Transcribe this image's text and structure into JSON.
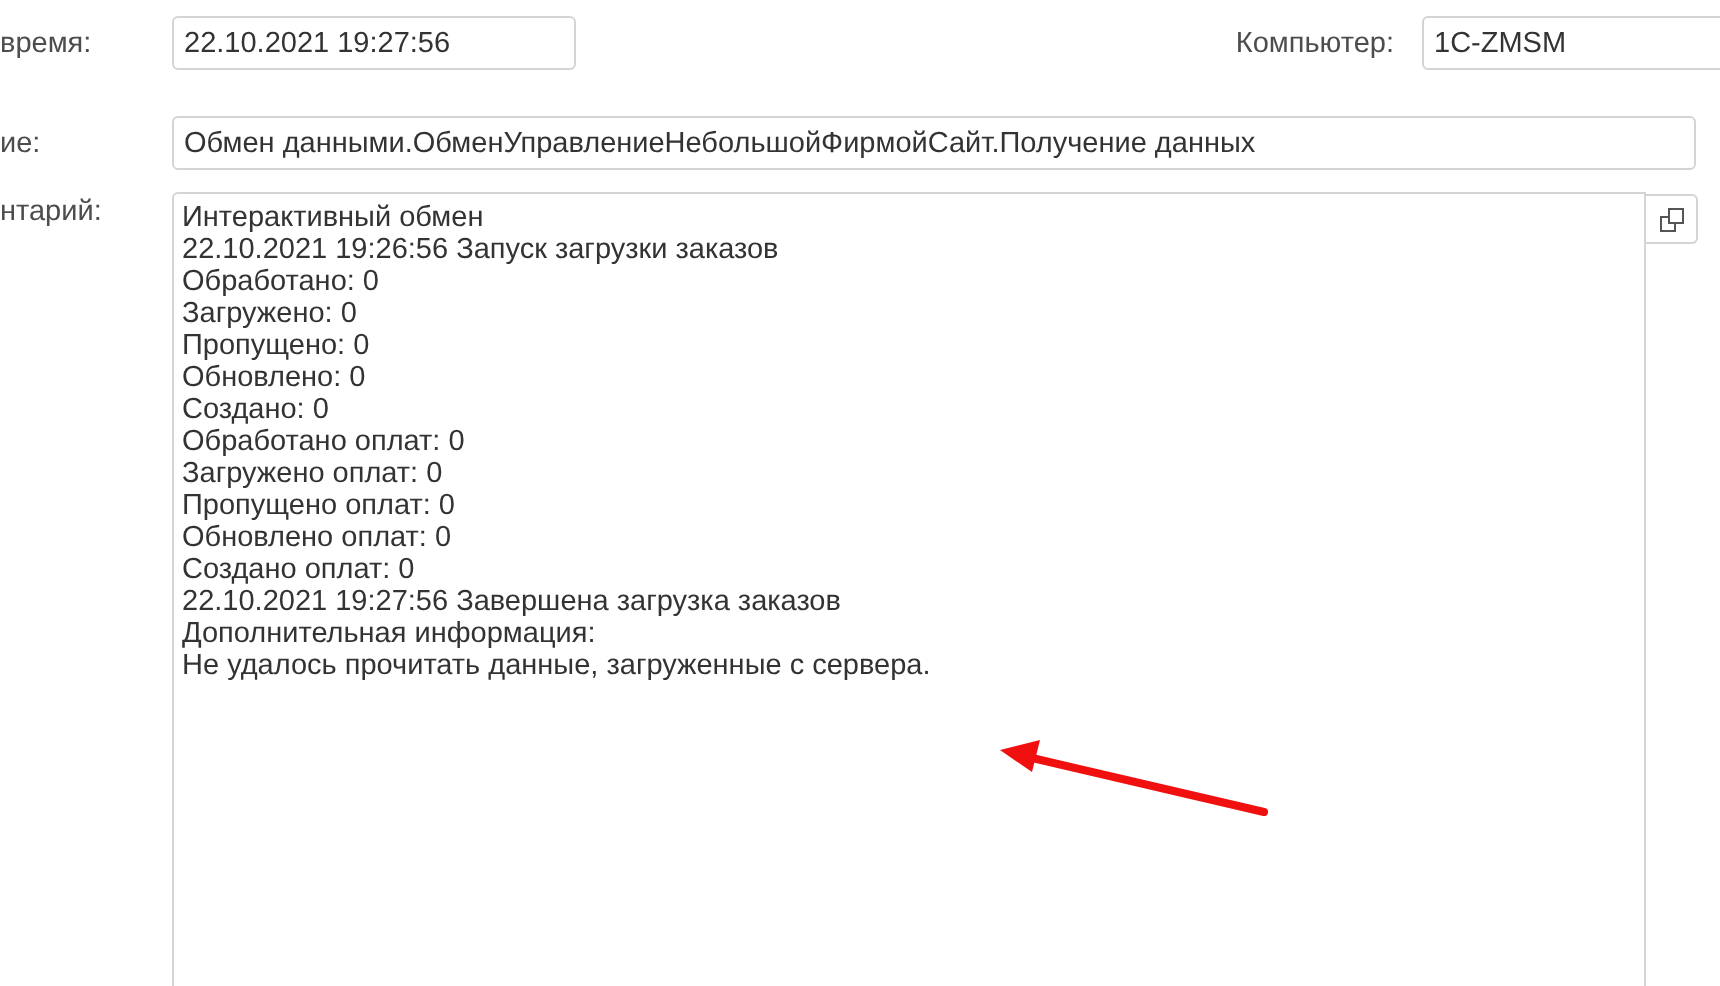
{
  "date": {
    "label": "время:",
    "value": "22.10.2021 19:27:56"
  },
  "computer": {
    "label": "Компьютер:",
    "value": "1C-ZMSM"
  },
  "name": {
    "label": "ие:",
    "value": "Обмен данными.ОбменУправлениеНебольшойФирмойСайт.Получение данных"
  },
  "comment": {
    "label": "нтарий:",
    "lines": [
      "Интерактивный обмен",
      "22.10.2021 19:26:56 Запуск загрузки заказов",
      "Обработано: 0",
      "Загружено: 0",
      "Пропущено: 0",
      "Обновлено: 0",
      "Создано: 0",
      "Обработано оплат: 0",
      "Загружено оплат: 0",
      "Пропущено оплат: 0",
      "Обновлено оплат: 0",
      "Создано оплат: 0",
      "22.10.2021 19:27:56 Завершена загрузка заказов",
      "Дополнительная информация:",
      "Не удалось прочитать данные, загруженные с сервера."
    ]
  }
}
